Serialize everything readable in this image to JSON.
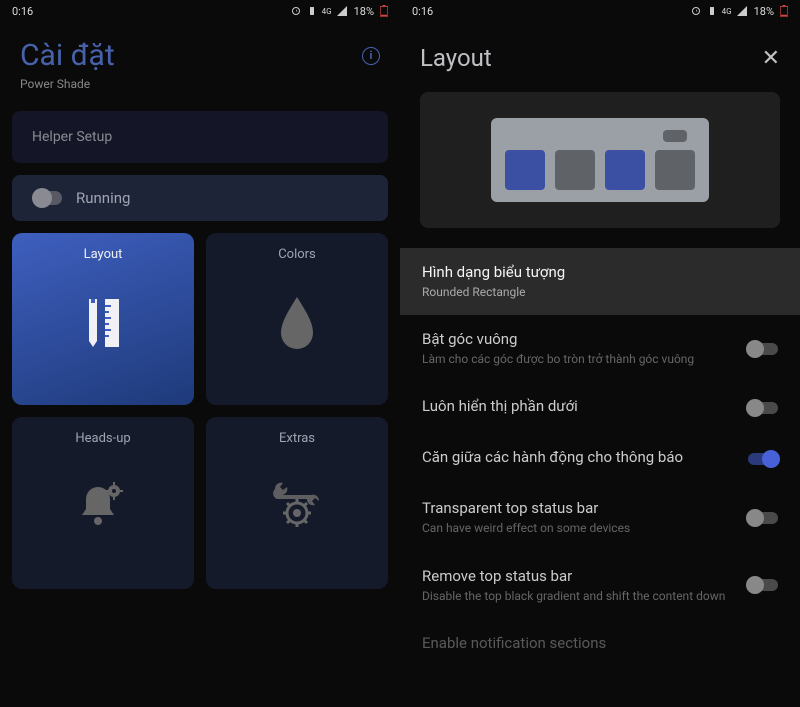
{
  "statusBar": {
    "time": "0:16",
    "battery": "18%",
    "network": "4G"
  },
  "left": {
    "title": "Cài đặt",
    "subtitle": "Power Shade",
    "helperSetup": "Helper Setup",
    "running": "Running",
    "tiles": {
      "layout": "Layout",
      "colors": "Colors",
      "headsUp": "Heads-up",
      "extras": "Extras"
    }
  },
  "right": {
    "title": "Layout",
    "items": {
      "iconShape": {
        "title": "Hình dạng biểu tượng",
        "sub": "Rounded Rectangle"
      },
      "squareCorners": {
        "title": "Bật góc vuông",
        "sub": "Làm cho các góc được bo tròn trở thành góc vuông"
      },
      "alwaysShowBottom": {
        "title": "Luôn hiển thị phần dưới"
      },
      "centerActions": {
        "title": "Căn giữa các hành động cho thông báo"
      },
      "transparentTop": {
        "title": "Transparent top status bar",
        "sub": "Can have weird effect on some devices"
      },
      "removeTop": {
        "title": "Remove top status bar",
        "sub": "Disable the top black gradient and shift the content down"
      },
      "enableSections": {
        "title": "Enable notification sections"
      }
    }
  }
}
